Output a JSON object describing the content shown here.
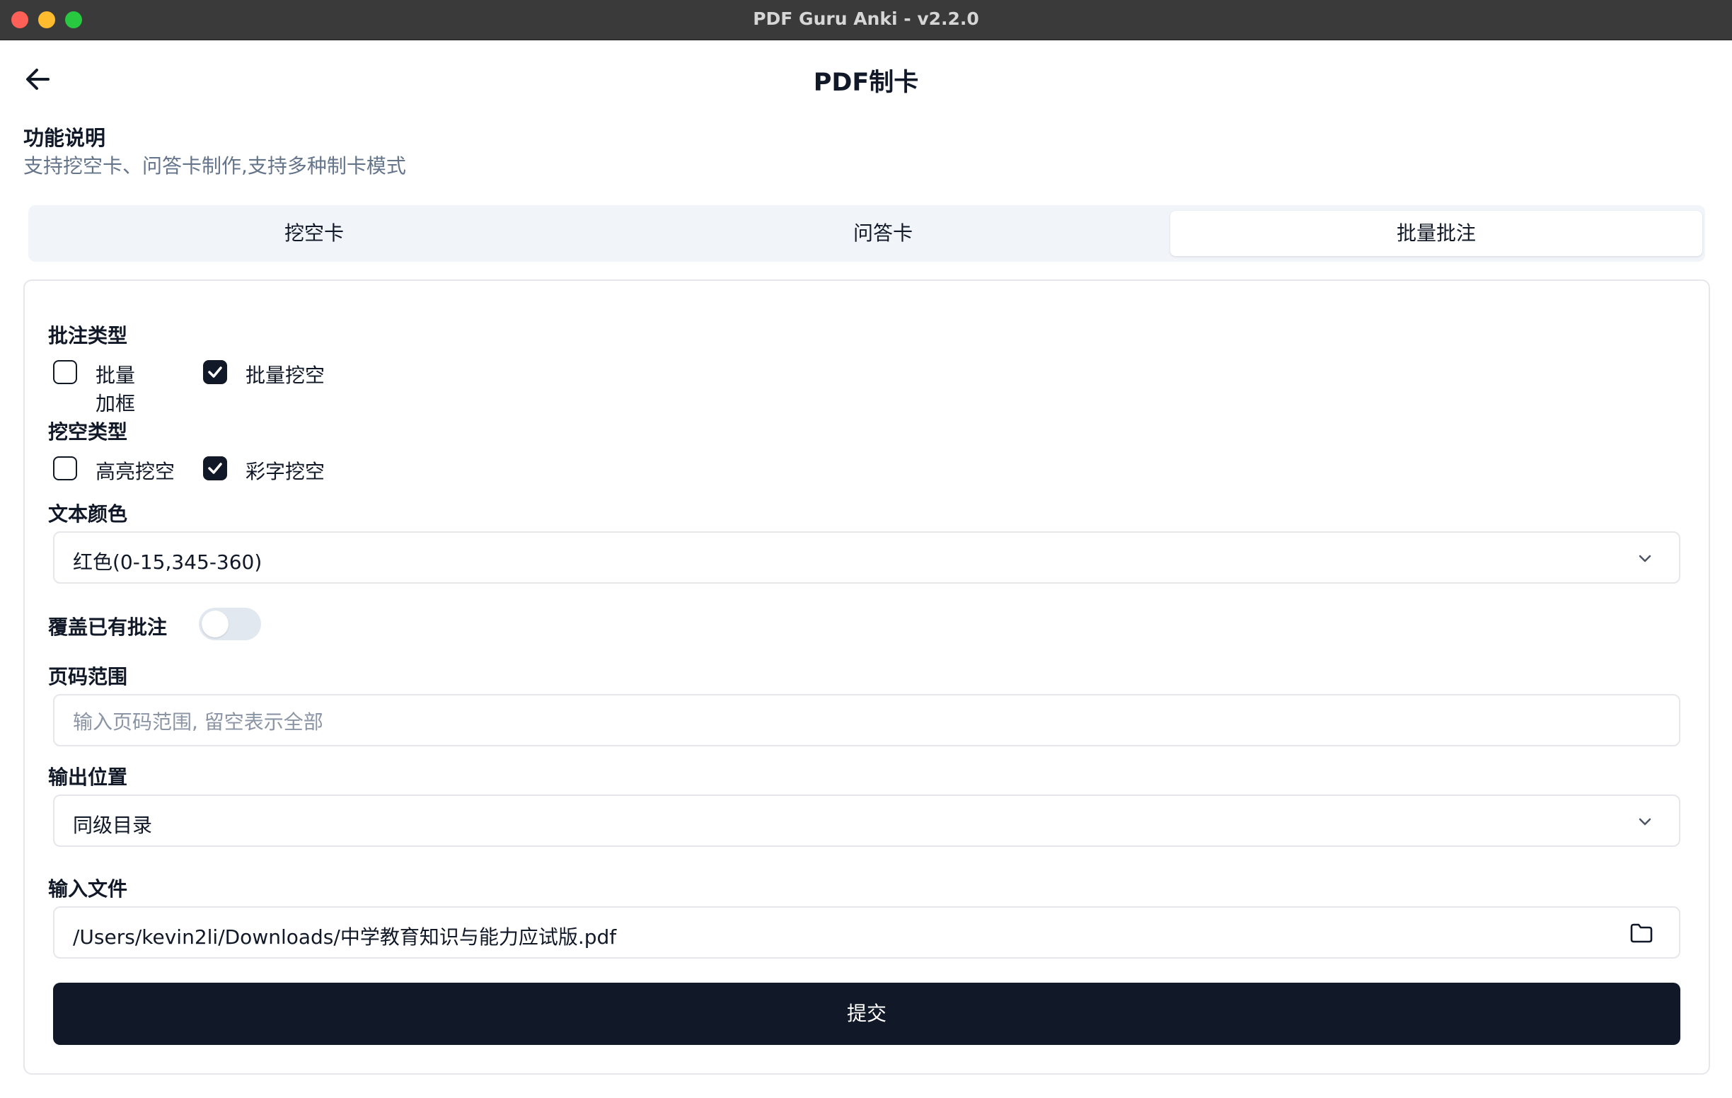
{
  "window": {
    "title": "PDF Guru Anki - v2.2.0"
  },
  "header": {
    "title": "PDF制卡",
    "back_icon": "arrow-left-icon"
  },
  "feature": {
    "title": "功能说明",
    "description": "支持挖空卡、问答卡制作,支持多种制卡模式"
  },
  "tabs": [
    {
      "label": "挖空卡",
      "active": false
    },
    {
      "label": "问答卡",
      "active": false
    },
    {
      "label": "批量批注",
      "active": true
    }
  ],
  "form": {
    "annotation_type": {
      "label": "批注类型",
      "options": [
        {
          "label": "批量加框",
          "checked": false
        },
        {
          "label": "批量挖空",
          "checked": true
        }
      ]
    },
    "cloze_type": {
      "label": "挖空类型",
      "options": [
        {
          "label": "高亮挖空",
          "checked": false
        },
        {
          "label": "彩字挖空",
          "checked": true
        }
      ]
    },
    "text_color": {
      "label": "文本颜色",
      "value": "红色(0-15,345-360)"
    },
    "overwrite": {
      "label": "覆盖已有批注",
      "enabled": false
    },
    "page_range": {
      "label": "页码范围",
      "value": "",
      "placeholder": "输入页码范围, 留空表示全部"
    },
    "output": {
      "label": "输出位置",
      "value": "同级目录"
    },
    "input_file": {
      "label": "输入文件",
      "value": "/Users/kevin2li/Downloads/中学教育知识与能力应试版.pdf"
    },
    "submit_label": "提交"
  },
  "colors": {
    "primary": "#111827",
    "muted_text": "#64748b",
    "tab_bg": "#f1f5f9",
    "border": "#e5e7eb"
  }
}
